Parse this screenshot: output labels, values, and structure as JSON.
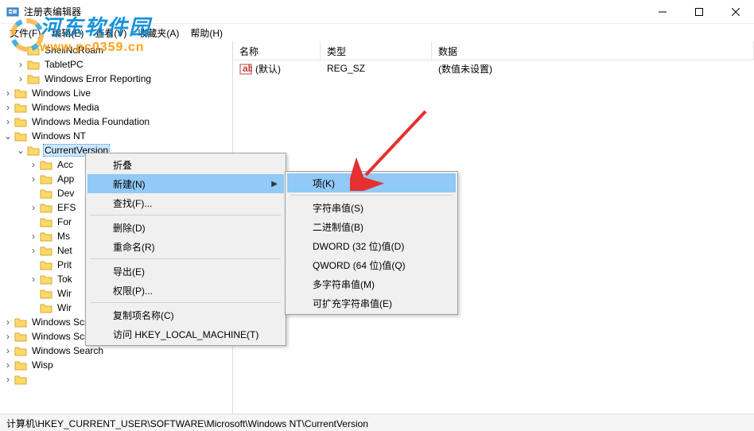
{
  "window": {
    "title": "注册表编辑器"
  },
  "menubar": {
    "file": "文件(F)",
    "edit": "编辑(E)",
    "view": "查看(V)",
    "favorites": "收藏夹(A)",
    "help": "帮助(H)"
  },
  "tree": {
    "items": [
      {
        "label": "ShellNoRoam",
        "indent": 1,
        "expander": ""
      },
      {
        "label": "TabletPC",
        "indent": 1,
        "expander": "›"
      },
      {
        "label": "Windows Error Reporting",
        "indent": 1,
        "expander": "›"
      },
      {
        "label": "Windows Live",
        "indent": 0,
        "expander": "›"
      },
      {
        "label": "Windows Media",
        "indent": 0,
        "expander": "›"
      },
      {
        "label": "Windows Media Foundation",
        "indent": 0,
        "expander": "›"
      },
      {
        "label": "Windows NT",
        "indent": 0,
        "expander": "⌄"
      },
      {
        "label": "CurrentVersion",
        "indent": 1,
        "expander": "⌄",
        "highlighted": true
      },
      {
        "label": "Accessibility",
        "indent": 2,
        "expander": "›",
        "partial": "Acc"
      },
      {
        "label": "AppCompatFlags",
        "indent": 2,
        "expander": "›",
        "partial": "App"
      },
      {
        "label": "Devices",
        "indent": 2,
        "expander": "",
        "partial": "Dev"
      },
      {
        "label": "EFS",
        "indent": 2,
        "expander": "›",
        "partial": "EFS"
      },
      {
        "label": "Fonts",
        "indent": 2,
        "expander": "",
        "partial": "For"
      },
      {
        "label": "MsiCorruptedFileRecovery",
        "indent": 2,
        "expander": "›",
        "partial": "Ms"
      },
      {
        "label": "Network",
        "indent": 2,
        "expander": "›",
        "partial": "Net"
      },
      {
        "label": "PrinterPorts",
        "indent": 2,
        "expander": "",
        "partial": "Prit"
      },
      {
        "label": "TokenBroker",
        "indent": 2,
        "expander": "›",
        "partial": "Tok"
      },
      {
        "label": "Windows",
        "indent": 2,
        "expander": "",
        "partial": "Wir"
      },
      {
        "label": "Winlogon",
        "indent": 2,
        "expander": "",
        "partial": "Wir"
      },
      {
        "label": "Windows Script",
        "indent": 0,
        "expander": "›"
      },
      {
        "label": "Windows Script Host",
        "indent": 0,
        "expander": "›"
      },
      {
        "label": "Windows Search",
        "indent": 0,
        "expander": "›"
      },
      {
        "label": "Wisp",
        "indent": 0,
        "expander": "›"
      }
    ],
    "bottom_extra": ""
  },
  "list": {
    "columns": {
      "name": "名称",
      "type": "类型",
      "data": "数据"
    },
    "row1": {
      "name": "(默认)",
      "type": "REG_SZ",
      "data": "(数值未设置)"
    }
  },
  "context_menu1": {
    "collapse": "折叠",
    "new": "新建(N)",
    "find": "查找(F)...",
    "delete": "删除(D)",
    "rename": "重命名(R)",
    "export": "导出(E)",
    "permissions": "权限(P)...",
    "copy_key": "复制项名称(C)",
    "goto": "访问 HKEY_LOCAL_MACHINE(T)"
  },
  "context_menu2": {
    "key": "项(K)",
    "string": "字符串值(S)",
    "binary": "二进制值(B)",
    "dword": "DWORD (32 位)值(D)",
    "qword": "QWORD (64 位)值(Q)",
    "multi": "多字符串值(M)",
    "expand": "可扩充字符串值(E)"
  },
  "statusbar": {
    "path": "计算机\\HKEY_CURRENT_USER\\SOFTWARE\\Microsoft\\Windows NT\\CurrentVersion"
  },
  "watermark": {
    "line1": "河东软件园",
    "line2": "www.pc0359.cn"
  }
}
